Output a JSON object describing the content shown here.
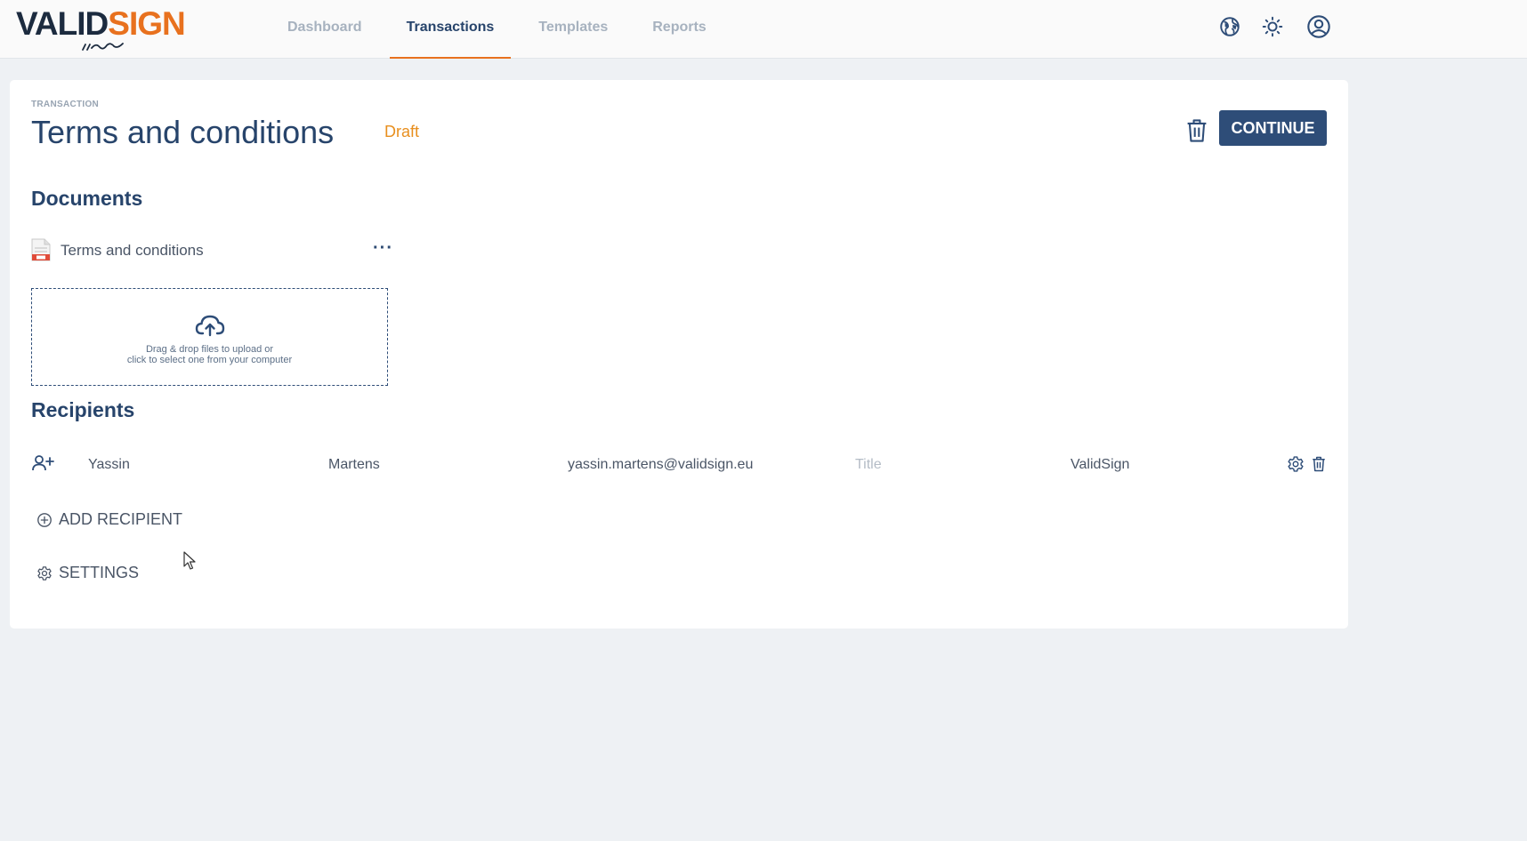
{
  "brand": {
    "part1": "VALID",
    "part2": "SIGN"
  },
  "nav": {
    "tabs": [
      {
        "label": "Dashboard"
      },
      {
        "label": "Transactions"
      },
      {
        "label": "Templates"
      },
      {
        "label": "Reports"
      }
    ],
    "active": "Transactions"
  },
  "header_icons": [
    "globe-icon",
    "sun-icon",
    "user-account-icon"
  ],
  "transaction": {
    "eyebrow": "TRANSACTION",
    "title": "Terms and conditions",
    "status": "Draft",
    "continue_label": "CONTINUE"
  },
  "documents": {
    "heading": "Documents",
    "items": [
      {
        "name": "Terms and conditions",
        "menu": "···"
      }
    ],
    "dropzone": {
      "line1": "Drag & drop files to upload or",
      "line2": "click to select one from your computer"
    }
  },
  "recipients": {
    "heading": "Recipients",
    "rows": [
      {
        "first_name": "Yassin",
        "last_name": "Martens",
        "email": "yassin.martens@validsign.eu",
        "title_placeholder": "Title",
        "company": "ValidSign"
      }
    ],
    "add_label": "ADD RECIPIENT"
  },
  "settings_label": "SETTINGS",
  "colors": {
    "accent_orange": "#e8711e",
    "primary_navy": "#2e4d78",
    "background": "#eef1f4",
    "draft_status": "#e88f1e"
  }
}
